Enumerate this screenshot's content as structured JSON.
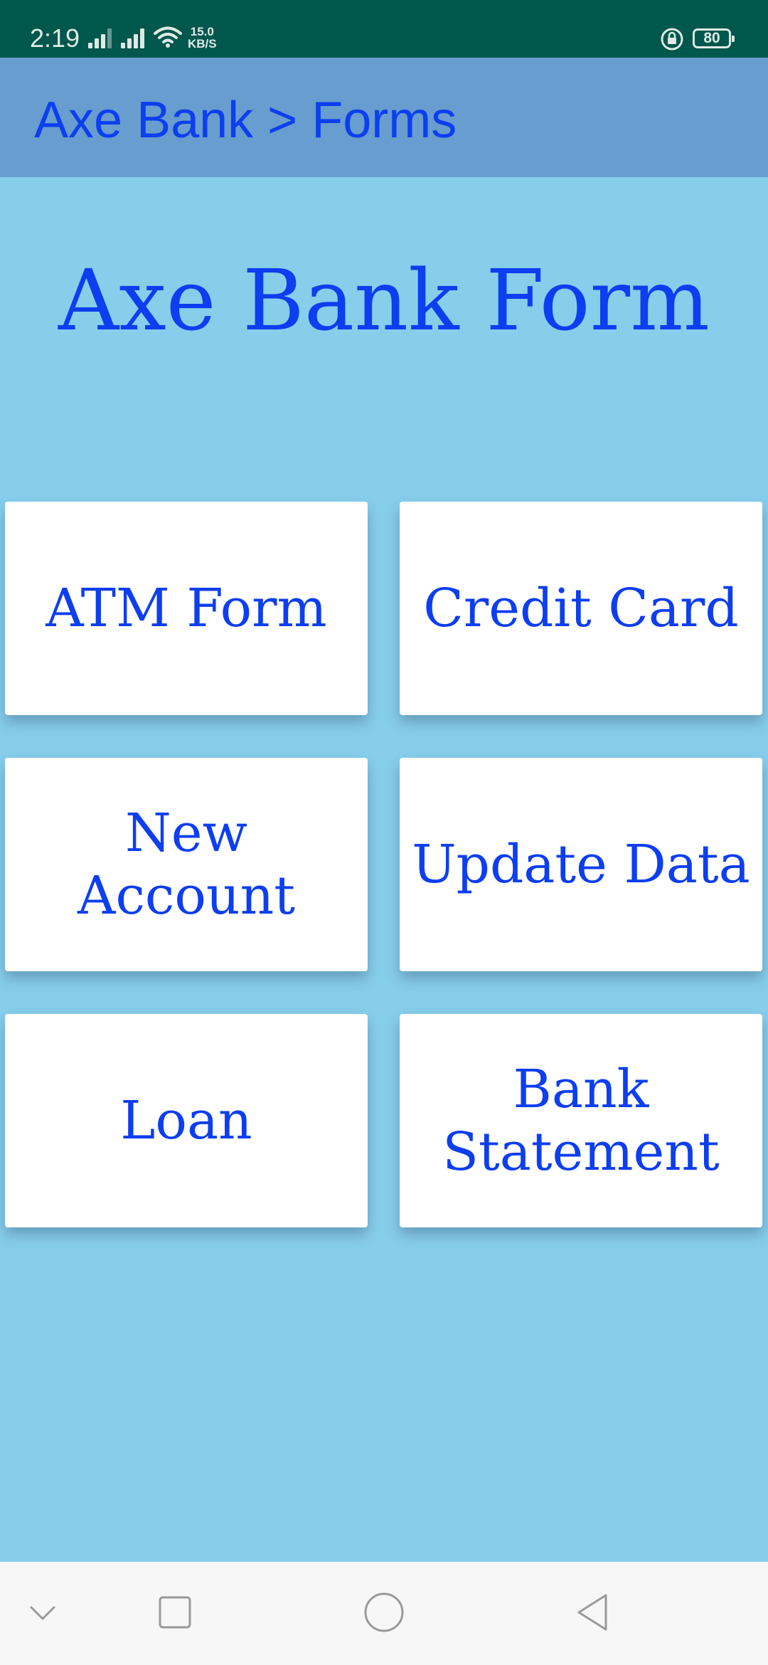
{
  "status_bar": {
    "time": "2:19",
    "net_speed_value": "15.0",
    "net_speed_unit": "KB/S",
    "battery": "80",
    "background_color": "#00574B"
  },
  "app_bar": {
    "title": "Axe Bank > Forms",
    "background_color": "#679DCF"
  },
  "main": {
    "heading": "Axe Bank Form",
    "background_color": "#87CEEB",
    "text_color": "#0D3EF0",
    "tiles": [
      {
        "label": "ATM Form"
      },
      {
        "label": "Credit Card"
      },
      {
        "label": "New Account"
      },
      {
        "label": "Update Data"
      },
      {
        "label": "Loan"
      },
      {
        "label": "Bank\nStatement"
      }
    ]
  },
  "nav_bar": {
    "icons": [
      "chevron-down-icon",
      "recents-square-icon",
      "home-circle-icon",
      "back-triangle-icon"
    ]
  }
}
